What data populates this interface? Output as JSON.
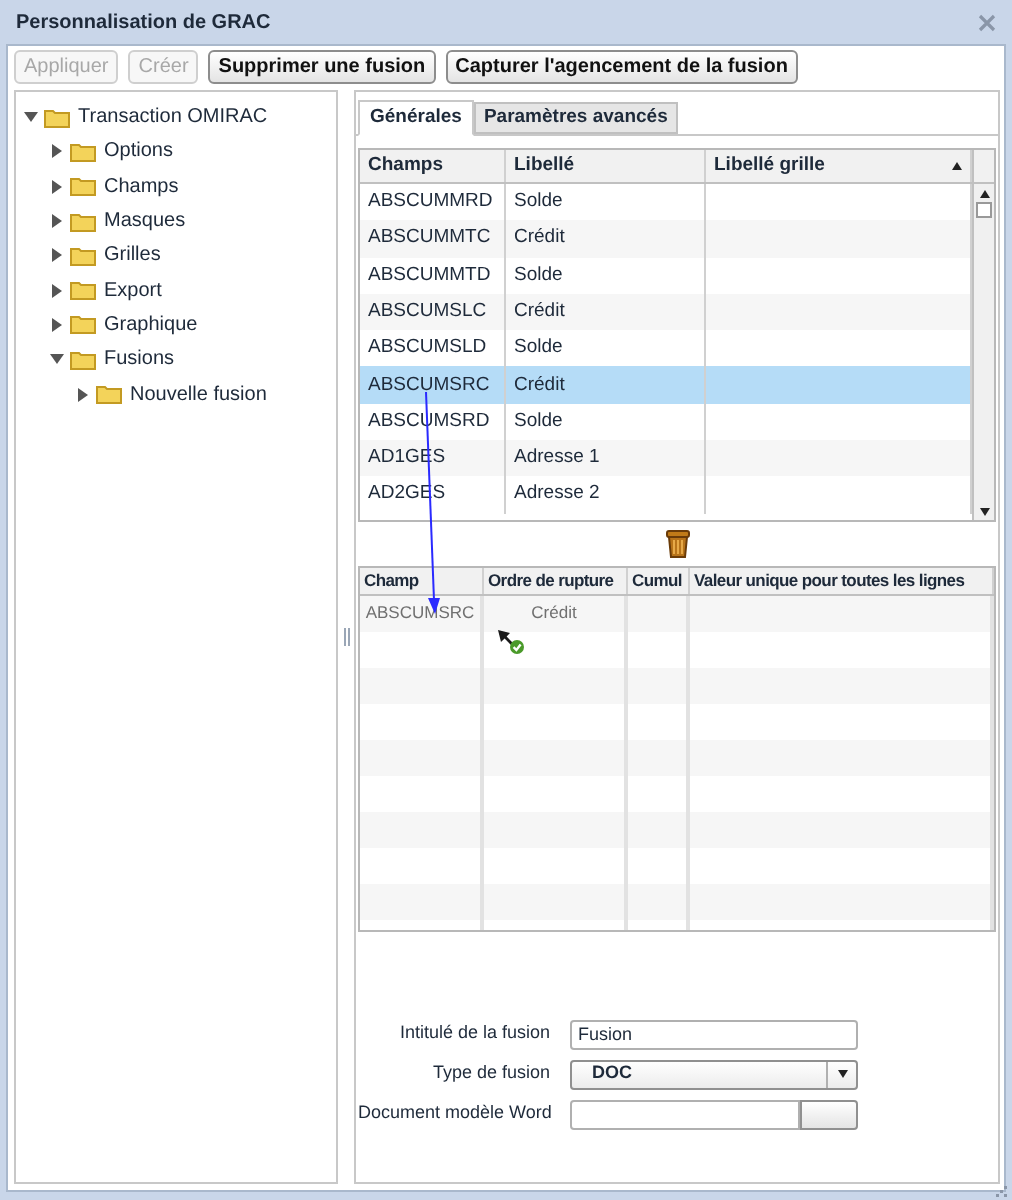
{
  "window": {
    "title": "Personnalisation de GRAC"
  },
  "toolbar": [
    {
      "label": "Appliquer",
      "disabled": true
    },
    {
      "label": "Créer",
      "disabled": true
    },
    {
      "label": "Supprimer une fusion",
      "disabled": false
    },
    {
      "label": "Capturer l'agencement de la fusion",
      "disabled": false
    }
  ],
  "tree": [
    {
      "label": "Transaction OMIRAC",
      "expanded": true,
      "children": [
        {
          "label": "Options",
          "expanded": false
        },
        {
          "label": "Champs",
          "expanded": false
        },
        {
          "label": "Masques",
          "expanded": false
        },
        {
          "label": "Grilles",
          "expanded": false
        },
        {
          "label": "Export",
          "expanded": false
        },
        {
          "label": "Graphique",
          "expanded": false
        },
        {
          "label": "Fusions",
          "expanded": true,
          "children": [
            {
              "label": "Nouvelle fusion",
              "expanded": false
            }
          ]
        }
      ]
    }
  ],
  "tabs": [
    {
      "label": "Générales",
      "selected": true
    },
    {
      "label": "Paramètres avancés",
      "selected": false
    }
  ],
  "fields_grid": {
    "columns": [
      "Champs",
      "Libellé",
      "Libellé grille"
    ],
    "rows": [
      {
        "cells": [
          "ABSCUMMRD",
          "Solde",
          ""
        ],
        "selected": false
      },
      {
        "cells": [
          "ABSCUMMTC",
          "Crédit",
          ""
        ],
        "selected": false
      },
      {
        "cells": [
          "ABSCUMMTD",
          "Solde",
          ""
        ],
        "selected": false
      },
      {
        "cells": [
          "ABSCUMSLC",
          "Crédit",
          ""
        ],
        "selected": false
      },
      {
        "cells": [
          "ABSCUMSLD",
          "Solde",
          ""
        ],
        "selected": false
      },
      {
        "cells": [
          "ABSCUMSRC",
          "Crédit",
          ""
        ],
        "selected": true
      },
      {
        "cells": [
          "ABSCUMSRD",
          "Solde",
          ""
        ],
        "selected": false
      },
      {
        "cells": [
          "AD1GES",
          "Adresse 1",
          ""
        ],
        "selected": false
      },
      {
        "cells": [
          "AD2GES",
          "Adresse 2",
          ""
        ],
        "selected": false
      }
    ]
  },
  "merge_grid": {
    "columns": [
      "Champ",
      "Ordre de rupture",
      "Cumul",
      "Valeur unique pour toutes les lignes"
    ],
    "rows": [
      {
        "cells": [
          "ABSCUMSRC",
          "Crédit",
          "",
          ""
        ]
      }
    ]
  },
  "form": [
    {
      "kind": "text",
      "label": "Intitulé de la fusion",
      "value": "Fusion"
    },
    {
      "kind": "select",
      "label": "Type de fusion",
      "value": "DOC"
    },
    {
      "kind": "file",
      "label": "Document modèle Word"
    }
  ]
}
